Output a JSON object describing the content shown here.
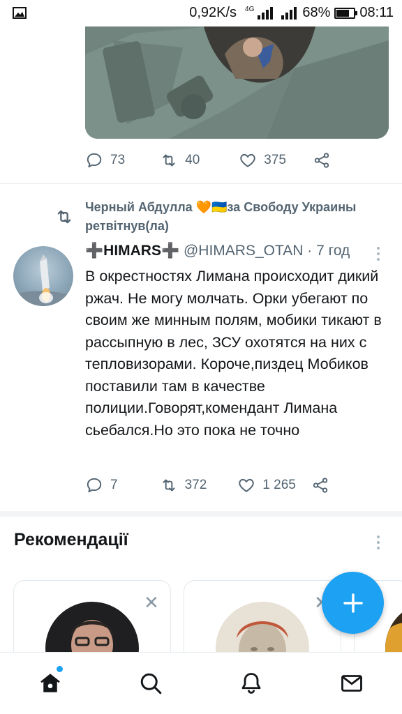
{
  "status_bar": {
    "speed": "0,92K/s",
    "network": "4G",
    "battery_percent": "68%",
    "battery_level": 0.68,
    "time": "08:11"
  },
  "prev_tweet": {
    "replies": "73",
    "retweets": "40",
    "likes": "375"
  },
  "retweet_banner": {
    "text": "Черный Абдулла 🧡🇺🇦за Свободу Украины ретвітнув(ла)"
  },
  "tweet": {
    "name": "➕HIMARS➕",
    "handle": "@HIMARS_OTAN",
    "separator": "·",
    "time": "7 год",
    "text": "В окрестностях Лимана происходит дикий ржач. Не могу молчать. Орки убегают по своим же минным полям, мобики тикают в рассыпную в лес, ЗСУ охотятся на них с тепловизорами. Короче,пиздец Мобиков поставили там в качестве полиции.Говорят,комендант Лимана сьебался.Но это пока не точно",
    "replies": "7",
    "retweets": "372",
    "likes": "1 265"
  },
  "recommendations": {
    "title": "Рекомендації",
    "close_symbol": "✕"
  },
  "colors": {
    "accent": "#1da1f2",
    "muted": "#536471"
  }
}
